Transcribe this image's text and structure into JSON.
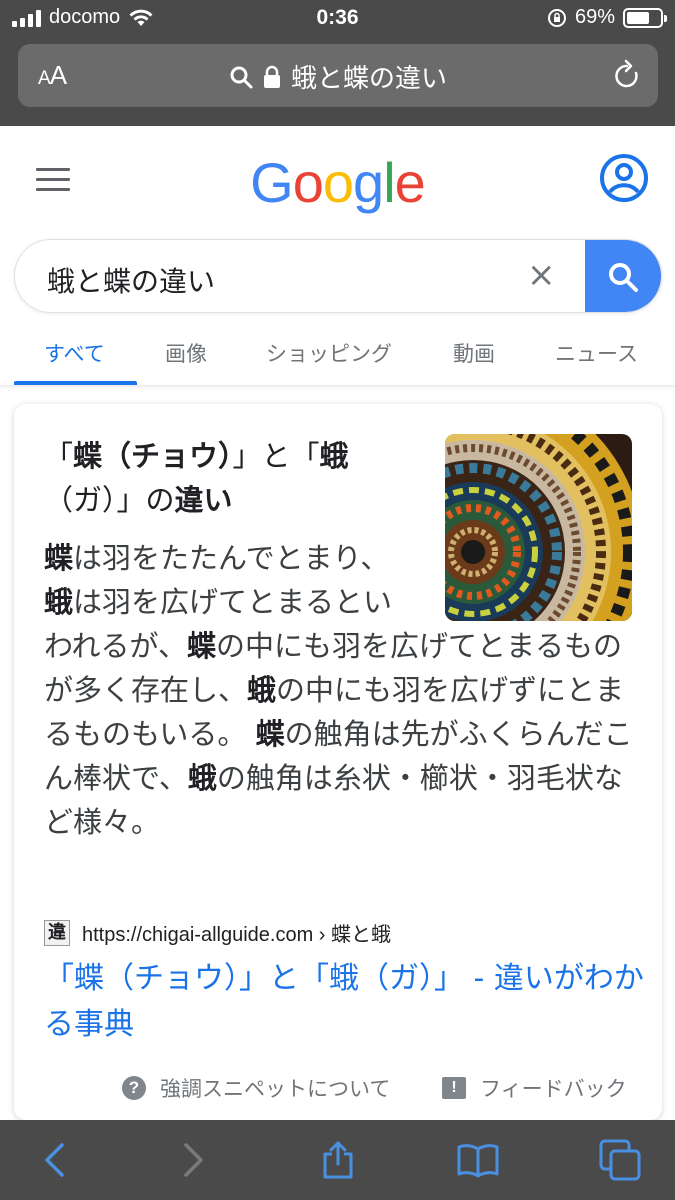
{
  "status_bar": {
    "carrier": "docomo",
    "time": "0:36",
    "battery_percent": "69%",
    "battery_level": 0.69
  },
  "browser": {
    "text_size_label_small": "A",
    "text_size_label_large": "A",
    "address_text": "蛾と蝶の違い"
  },
  "google": {
    "logo_letters": [
      "G",
      "o",
      "o",
      "g",
      "l",
      "e"
    ],
    "logo_colors": [
      "#4285f4",
      "#ea4335",
      "#fbbc05",
      "#4285f4",
      "#34a853",
      "#ea4335"
    ],
    "search_value": "蛾と蝶の違い",
    "clear_symbol": "×",
    "accent_color": "#4285f4",
    "link_color": "#1a73e8"
  },
  "tabs": [
    {
      "label": "すべて",
      "active": true
    },
    {
      "label": "画像",
      "active": false
    },
    {
      "label": "ショッピング",
      "active": false
    },
    {
      "label": "動画",
      "active": false
    },
    {
      "label": "ニュース",
      "active": false
    }
  ],
  "featured_snippet": {
    "title_parts": [
      "「",
      "蝶（チョウ）",
      "」と「",
      "蛾",
      "（ガ）」の",
      "違い"
    ],
    "snippet_parts": [
      "蝶",
      "は羽をたたんでとまり、",
      "蛾",
      "は羽を広げてとまるといわれるが、",
      "蝶",
      "の中にも羽を広げてとまるものが多く存在し、",
      "蛾",
      "の中にも羽を広げずにとまるものもいる。 ",
      "蝶",
      "の触角は先がふくらんだこん棒状で、",
      "蛾",
      "の触角は糸状・櫛状・羽毛状など様々。"
    ],
    "favicon_char": "違",
    "source_url": "https://chigai-allguide.com",
    "source_path": " › 蝶と蛾",
    "result_title": "「蝶（チョウ）」と「蛾（ガ）」 - 違いがわかる事典",
    "footer_about": "強調スニペットについて",
    "footer_feedback": "フィードバック"
  },
  "icons": {
    "hamburger": "menu-icon",
    "account": "account-circle-icon",
    "search": "search-icon",
    "lock": "lock-icon",
    "reload": "reload-icon",
    "back": "back-arrow-icon",
    "forward": "forward-arrow-icon",
    "share": "share-icon",
    "bookmarks": "book-icon",
    "tabs": "tabs-icon"
  }
}
